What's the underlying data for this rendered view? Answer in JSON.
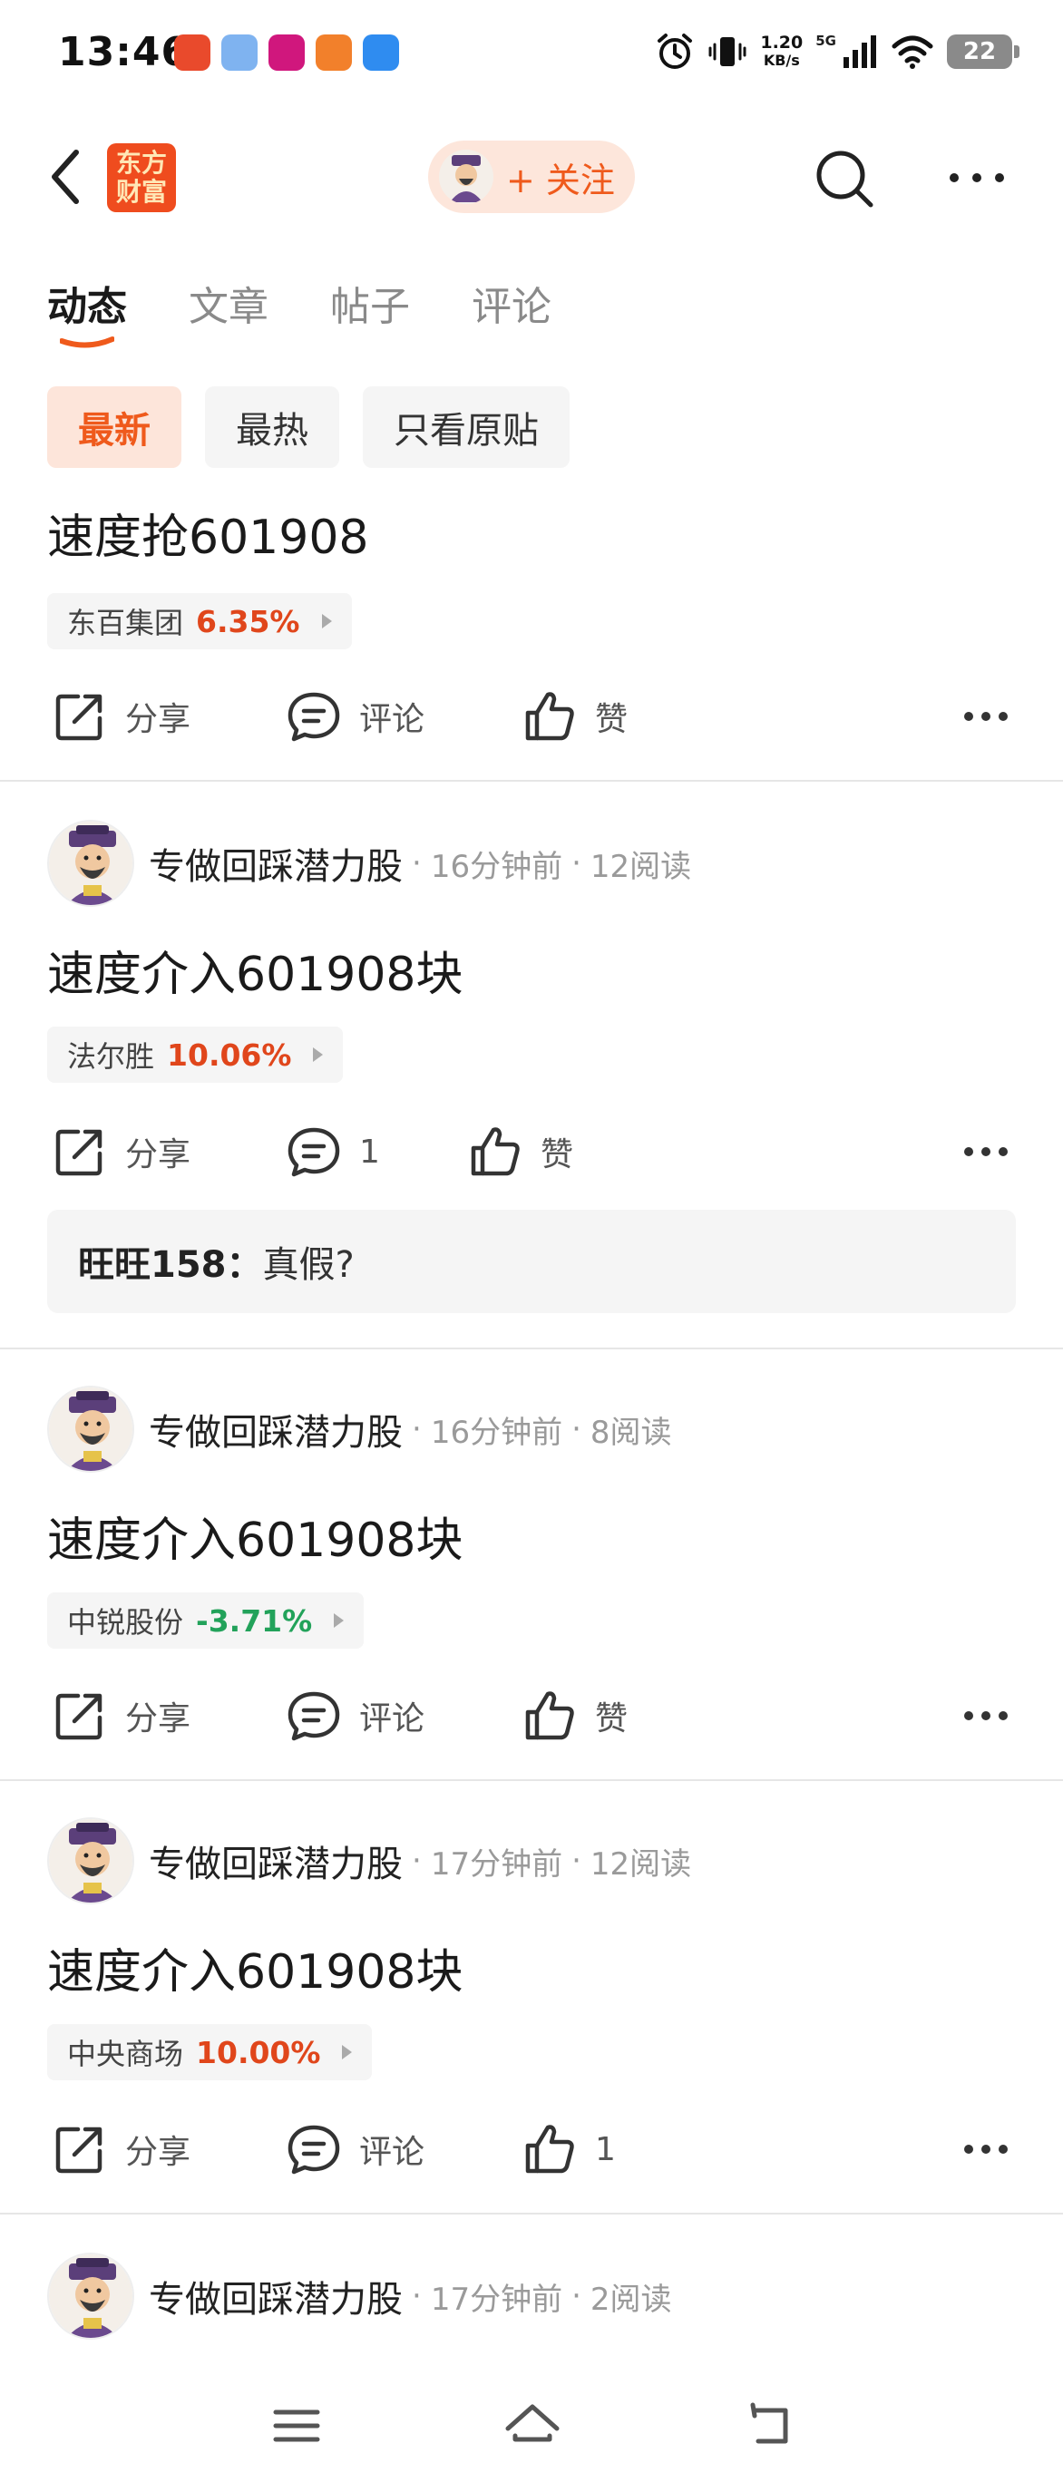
{
  "status_bar": {
    "time": "13:46",
    "net_speed_value": "1.20",
    "net_speed_unit": "KB/s",
    "network_gen": "5G",
    "battery": "22"
  },
  "header": {
    "logo_text_line1": "东方",
    "logo_text_line2": "财富",
    "follow_label": "+ 关注"
  },
  "tabs": [
    {
      "label": "动态",
      "active": true
    },
    {
      "label": "文章",
      "active": false
    },
    {
      "label": "帖子",
      "active": false
    },
    {
      "label": "评论",
      "active": false
    }
  ],
  "filters": [
    {
      "label": "最新",
      "active": true
    },
    {
      "label": "最热",
      "active": false
    },
    {
      "label": "只看原贴",
      "active": false
    }
  ],
  "posts": [
    {
      "text": "速度抢601908",
      "stock_name": "东百集团",
      "stock_change": "6.35%",
      "share_label": "分享",
      "comment_label": "评论",
      "like_label": "赞"
    },
    {
      "author": "专做回踩潜力股",
      "time_ago": "16分钟前",
      "reads": "12阅读",
      "text": "速度介入601908块",
      "stock_name": "法尔胜",
      "stock_change": "10.06%",
      "share_label": "分享",
      "comment_label": "1",
      "like_label": "赞",
      "comment_preview_user": "旺旺158：",
      "comment_preview_text": "真假?"
    },
    {
      "author": "专做回踩潜力股",
      "time_ago": "16分钟前",
      "reads": "8阅读",
      "text": "速度介入601908块",
      "stock_name": "中锐股份",
      "stock_change": "-3.71%",
      "share_label": "分享",
      "comment_label": "评论",
      "like_label": "赞"
    },
    {
      "author": "专做回踩潜力股",
      "time_ago": "17分钟前",
      "reads": "12阅读",
      "text": "速度介入601908块",
      "stock_name": "中央商场",
      "stock_change": "10.00%",
      "share_label": "分享",
      "comment_label": "评论",
      "like_label": "1"
    },
    {
      "author": "专做回踩潜力股",
      "time_ago": "17分钟前",
      "reads": "2阅读"
    }
  ],
  "colors": {
    "accent": "#ef5a1c",
    "up": "#e0461b",
    "down": "#22a25a"
  }
}
